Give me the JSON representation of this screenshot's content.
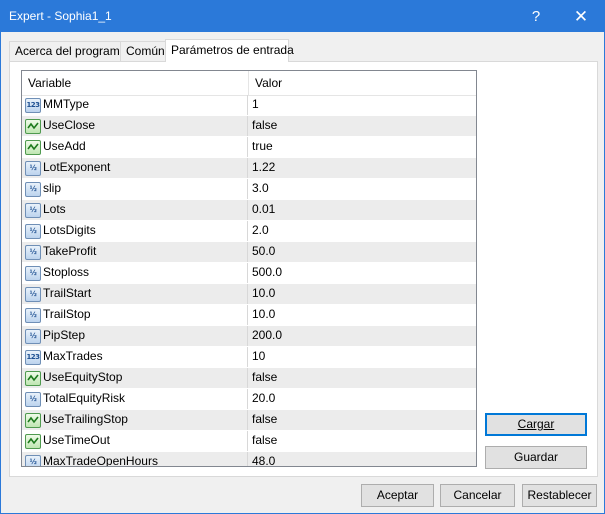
{
  "window": {
    "title": "Expert - Sophia1_1",
    "help_label": "?",
    "close_label": "✕"
  },
  "tabs": [
    {
      "label": "Acerca del programa",
      "active": false
    },
    {
      "label": "Común",
      "active": false
    },
    {
      "label": "Parámetros de entrada",
      "active": true
    }
  ],
  "grid": {
    "columns": [
      "Variable",
      "Valor"
    ],
    "rows": [
      {
        "name": "MMType",
        "value": "1",
        "icon": "integer-icon",
        "icon_text": "123"
      },
      {
        "name": "UseClose",
        "value": "false",
        "icon": "boolean-icon",
        "icon_text": ""
      },
      {
        "name": "UseAdd",
        "value": "true",
        "icon": "boolean-icon",
        "icon_text": ""
      },
      {
        "name": "LotExponent",
        "value": "1.22",
        "icon": "double-icon",
        "icon_text": "½"
      },
      {
        "name": "slip",
        "value": "3.0",
        "icon": "double-icon",
        "icon_text": "½"
      },
      {
        "name": "Lots",
        "value": "0.01",
        "icon": "double-icon",
        "icon_text": "½"
      },
      {
        "name": "LotsDigits",
        "value": "2.0",
        "icon": "double-icon",
        "icon_text": "½"
      },
      {
        "name": "TakeProfit",
        "value": "50.0",
        "icon": "double-icon",
        "icon_text": "½"
      },
      {
        "name": "Stoploss",
        "value": "500.0",
        "icon": "double-icon",
        "icon_text": "½"
      },
      {
        "name": "TrailStart",
        "value": "10.0",
        "icon": "double-icon",
        "icon_text": "½"
      },
      {
        "name": "TrailStop",
        "value": "10.0",
        "icon": "double-icon",
        "icon_text": "½"
      },
      {
        "name": "PipStep",
        "value": "200.0",
        "icon": "double-icon",
        "icon_text": "½"
      },
      {
        "name": "MaxTrades",
        "value": "10",
        "icon": "integer-icon",
        "icon_text": "123"
      },
      {
        "name": "UseEquityStop",
        "value": "false",
        "icon": "boolean-icon",
        "icon_text": ""
      },
      {
        "name": "TotalEquityRisk",
        "value": "20.0",
        "icon": "double-icon",
        "icon_text": "½"
      },
      {
        "name": "UseTrailingStop",
        "value": "false",
        "icon": "boolean-icon",
        "icon_text": ""
      },
      {
        "name": "UseTimeOut",
        "value": "false",
        "icon": "boolean-icon",
        "icon_text": ""
      },
      {
        "name": "MaxTradeOpenHours",
        "value": "48.0",
        "icon": "double-icon",
        "icon_text": "½"
      }
    ]
  },
  "side_buttons": {
    "load": "Cargar",
    "save": "Guardar"
  },
  "footer_buttons": {
    "ok": "Aceptar",
    "cancel": "Cancelar",
    "reset": "Restablecer"
  }
}
